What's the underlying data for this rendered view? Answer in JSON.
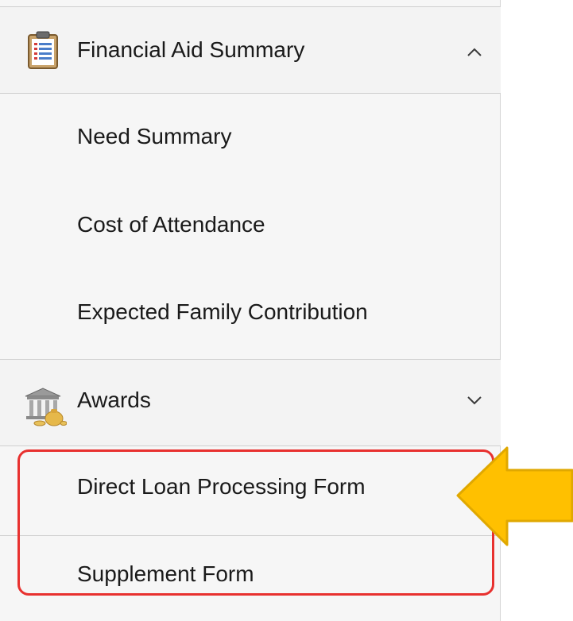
{
  "nav": {
    "groups": [
      {
        "label": "Financial Aid Summary",
        "icon": "clipboard-list-icon",
        "expanded": true,
        "items": [
          {
            "label": "Need Summary"
          },
          {
            "label": "Cost of Attendance"
          },
          {
            "label": "Expected Family Contribution"
          }
        ]
      },
      {
        "label": "Awards",
        "icon": "bank-moneybag-icon",
        "expanded": true,
        "items": [
          {
            "label": "Direct Loan Processing Form"
          },
          {
            "label": "Supplement Form"
          }
        ]
      }
    ]
  },
  "annotation": {
    "highlight_color": "#e8312f",
    "arrow_color": "#ffc000",
    "arrow_outline": "#e0a800"
  }
}
